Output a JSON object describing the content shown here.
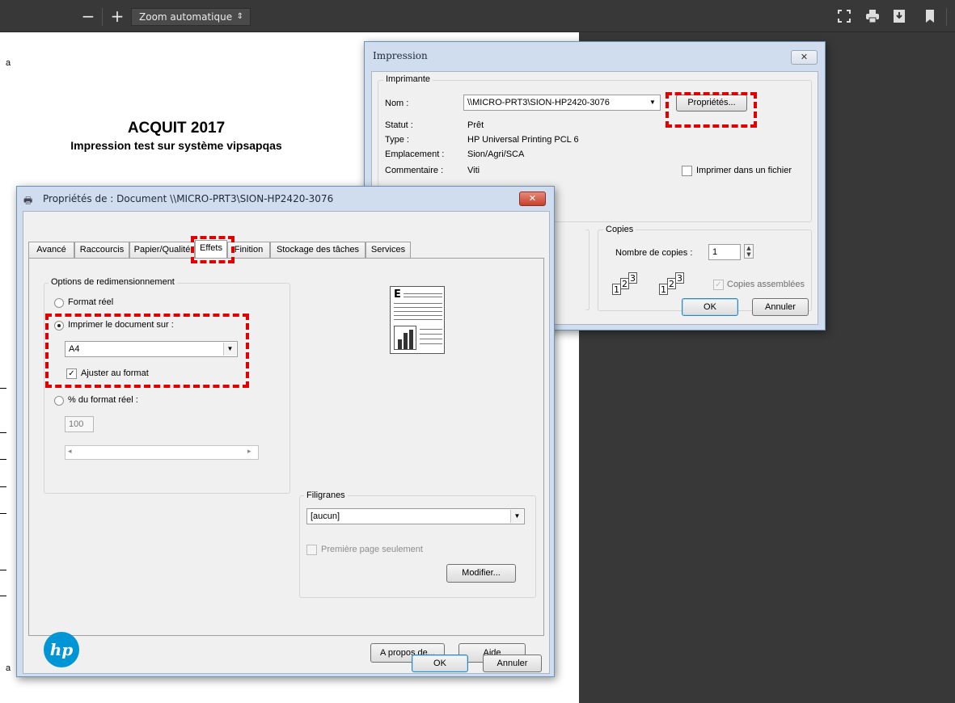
{
  "viewer": {
    "zoom_out": "−",
    "zoom_in": "+",
    "zoom_value": "Zoom automatique",
    "zoom_arrow": "⇕",
    "icons": [
      "presentation-mode-icon",
      "print-icon",
      "download-icon",
      "bookmark-icon"
    ]
  },
  "document": {
    "title": "ACQUIT 2017",
    "subtitle": "Impression test sur système vipsapqas",
    "fragment_top": "a",
    "fragment_bottom": "a"
  },
  "print_dialog": {
    "title": "Impression",
    "close": "✕",
    "printer_group": "Imprimante",
    "name_label": "Nom :",
    "name_value": "\\\\MICRO-PRT3\\SION-HP2420-3076",
    "properties_button": "Propriétés...",
    "status_label": "Statut :",
    "status_value": "Prêt",
    "type_label": "Type :",
    "type_value": "HP Universal Printing PCL 6",
    "location_label": "Emplacement :",
    "location_value": "Sion/Agri/SCA",
    "comment_label": "Commentaire :",
    "comment_value": "Viti",
    "print_to_file": "Imprimer dans un fichier",
    "copies_group": "Copies",
    "copies_label": "Nombre de copies :",
    "copies_value": "1",
    "collate": "Copies assemblées",
    "ok": "OK",
    "cancel": "Annuler"
  },
  "prop_dialog": {
    "title": "Propriétés de : Document \\\\MICRO-PRT3\\SION-HP2420-3076",
    "close": "✕",
    "tabs": [
      "Avancé",
      "Raccourcis",
      "Papier/Qualité",
      "Effets",
      "Finition",
      "Stockage des tâches",
      "Services"
    ],
    "resize_group": "Options de redimensionnement",
    "radio_actual": "Format réel",
    "radio_print_on": "Imprimer le document sur :",
    "paper_value": "A4",
    "fit_to_page": "Ajuster au format",
    "radio_percent": "% du format réel :",
    "percent_value": "100",
    "watermarks_group": "Filigranes",
    "watermark_value": "[aucun]",
    "first_page_only": "Première page seulement",
    "edit_button": "Modifier...",
    "about_button": "A propos de...",
    "help_button": "Aide",
    "ok": "OK",
    "cancel": "Annuler",
    "logo": "hp",
    "preview_letter": "E"
  }
}
